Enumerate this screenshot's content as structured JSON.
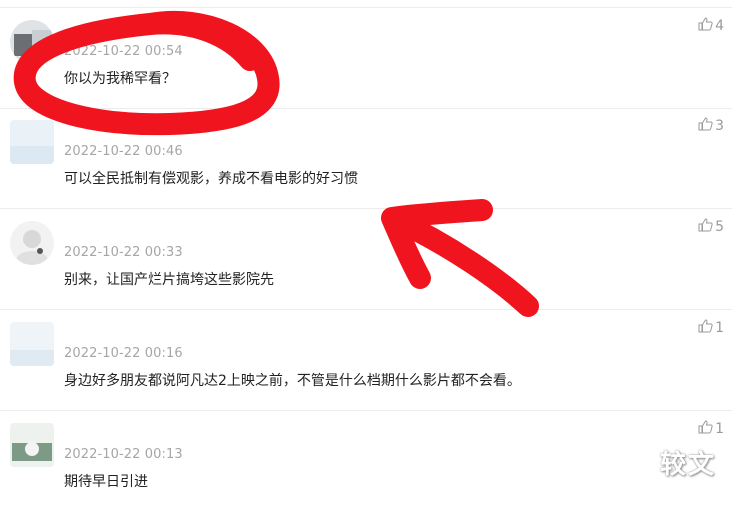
{
  "comments": [
    {
      "time": "2022-10-22 00:54",
      "text": "你以为我稀罕看？",
      "likes": "4"
    },
    {
      "time": "2022-10-22 00:46",
      "text": "可以全民抵制有偿观影，养成不看电影的好习惯",
      "likes": "3"
    },
    {
      "time": "2022-10-22 00:33",
      "text": "别来，让国产烂片搞垮这些影院先",
      "likes": "5"
    },
    {
      "time": "2022-10-22 00:16",
      "text": "身边好多朋友都说阿凡达2上映之前，不管是什么档期什么影片都不会看。",
      "likes": "1"
    },
    {
      "time": "2022-10-22 00:13",
      "text": "期待早日引进",
      "likes": "1"
    }
  ],
  "watermark": "较文",
  "colors": {
    "marker": "#f0141e",
    "time": "#a6a6a6",
    "divider": "#ececec"
  },
  "icons": {
    "like": "thumb-up-icon"
  }
}
